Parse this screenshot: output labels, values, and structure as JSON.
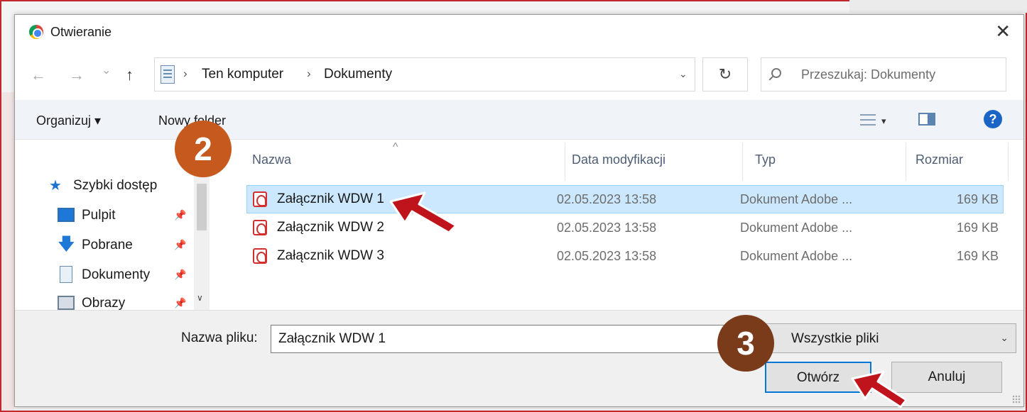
{
  "window": {
    "title": "Otwieranie",
    "close_glyph": "✕"
  },
  "nav": {
    "back": "←",
    "forward": "→",
    "recent": "⌄",
    "up": "↑",
    "refresh": "↻"
  },
  "address": {
    "crumbs": [
      "Ten komputer",
      "Dokumenty"
    ],
    "separator": "›",
    "dropdown": "⌄"
  },
  "search": {
    "placeholder": "Przeszukaj: Dokumenty"
  },
  "toolbar": {
    "organize": "Organizuj ▾",
    "new_folder": "Nowy folder",
    "caret": "▾",
    "help": "?"
  },
  "nav_pane": {
    "items": [
      {
        "label": "Szybki dostęp",
        "icon": "star-icon",
        "glyph": "★"
      },
      {
        "label": "Pulpit",
        "icon": "desktop-icon",
        "pinned": "📌"
      },
      {
        "label": "Pobrane",
        "icon": "download-icon",
        "glyph": "🡇",
        "pinned": "📌"
      },
      {
        "label": "Dokumenty",
        "icon": "documents-icon",
        "pinned": "📌"
      },
      {
        "label": "Obrazy",
        "icon": "pictures-icon",
        "pinned": "📌"
      }
    ],
    "scroll_down": "∨"
  },
  "file_list": {
    "columns": {
      "name": "Nazwa",
      "date": "Data modyfikacji",
      "type": "Typ",
      "size": "Rozmiar"
    },
    "sort_indicator": "^",
    "rows": [
      {
        "name": "Załącznik WDW 1",
        "date": "02.05.2023 13:58",
        "type": "Dokument Adobe ...",
        "size": "169 KB",
        "selected": true
      },
      {
        "name": "Załącznik WDW 2",
        "date": "02.05.2023 13:58",
        "type": "Dokument Adobe ...",
        "size": "169 KB",
        "selected": false
      },
      {
        "name": "Załącznik WDW 3",
        "date": "02.05.2023 13:58",
        "type": "Dokument Adobe ...",
        "size": "169 KB",
        "selected": false
      }
    ]
  },
  "footer": {
    "filename_label": "Nazwa pliku:",
    "filename_value": "Załącznik WDW 1",
    "filter_value": "Wszystkie pliki",
    "filter_caret": "⌄",
    "open_label": "Otwórz",
    "cancel_label": "Anuluj"
  },
  "annotations": {
    "step_2": "2",
    "step_3": "3",
    "badge_color_2": "#c65a1e",
    "badge_color_3": "#7a3b1a",
    "arrow_color": "#c0141c"
  },
  "colors": {
    "frame_border": "#c0282d",
    "selection": "#cce8ff",
    "accent": "#0078d7"
  }
}
